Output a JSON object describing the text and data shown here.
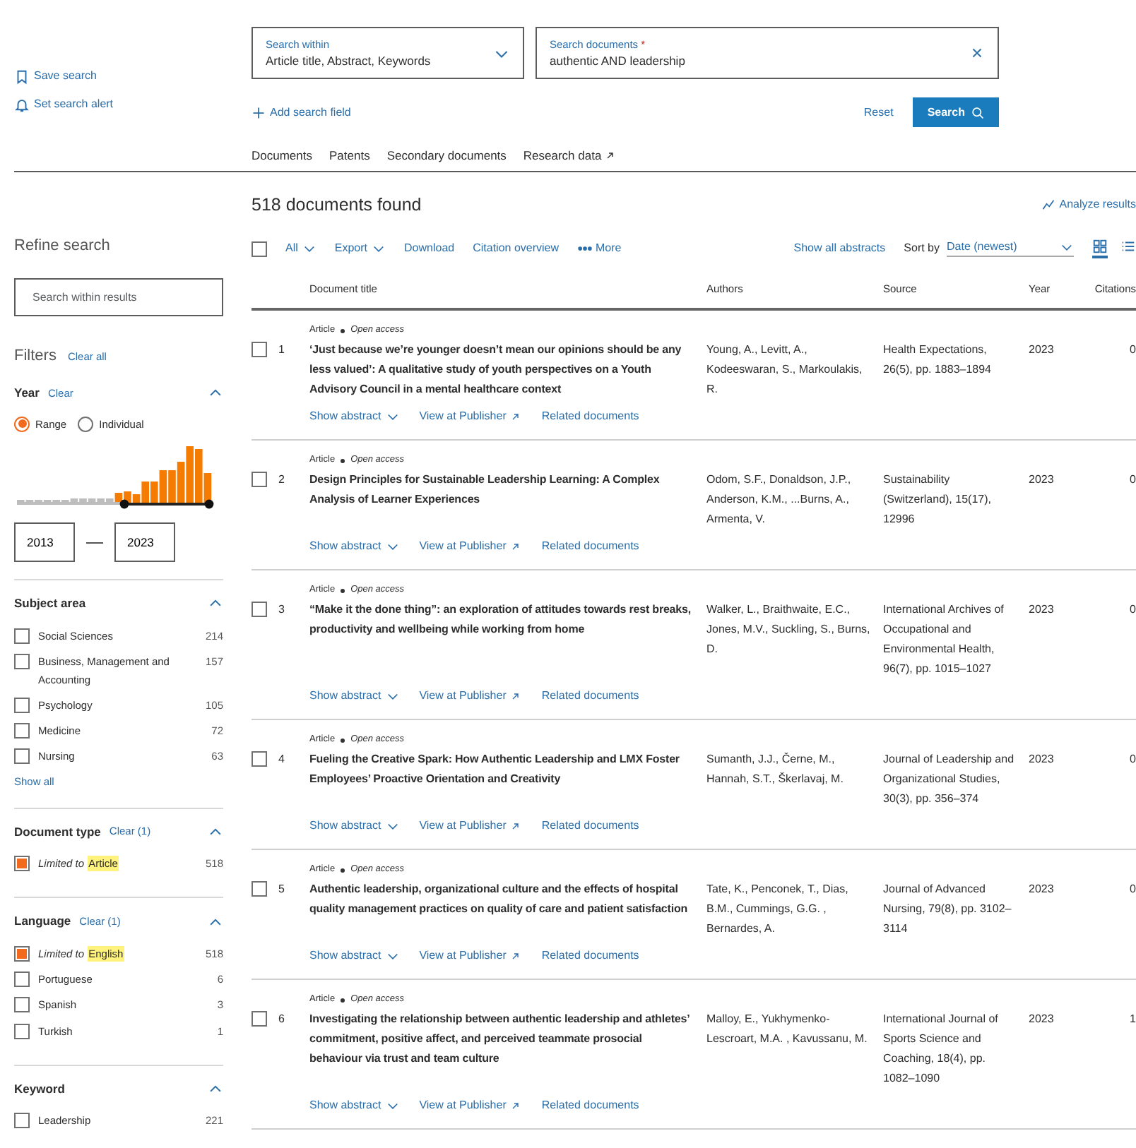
{
  "sidebar_actions": [
    {
      "kind": "bookmark",
      "label": "Save search"
    },
    {
      "kind": "bell",
      "label": "Set search alert"
    }
  ],
  "search": {
    "within": {
      "label": "Search within",
      "value": "Article title, Abstract, Keywords"
    },
    "query": {
      "label": "Search documents",
      "required_mark": "*",
      "value": "authentic AND leadership"
    },
    "add_field": "Add search field",
    "reset": "Reset",
    "submit": "Search"
  },
  "tabs": [
    {
      "label": "Documents",
      "external": false
    },
    {
      "label": "Patents",
      "external": false
    },
    {
      "label": "Secondary documents",
      "external": false
    },
    {
      "label": "Research data",
      "external": true
    }
  ],
  "refine": {
    "title": "Refine search",
    "placeholder": "Search within results"
  },
  "filters": {
    "title": "Filters",
    "clear_all": "Clear all"
  },
  "year": {
    "title": "Year",
    "clear": "Clear",
    "expanded": true,
    "modes": [
      {
        "label": "Range",
        "selected": true
      },
      {
        "label": "Individual",
        "selected": false
      }
    ],
    "from": "2013",
    "to": "2023"
  },
  "facets": [
    {
      "title": "Subject area",
      "expanded": true,
      "show_all": "Show all",
      "items": [
        {
          "label": "Social Sciences",
          "count": "214",
          "checked": false
        },
        {
          "label": "Business, Management and Accounting",
          "count": "157",
          "checked": false
        },
        {
          "label": "Psychology",
          "count": "105",
          "checked": false
        },
        {
          "label": "Medicine",
          "count": "72",
          "checked": false
        },
        {
          "label": "Nursing",
          "count": "63",
          "checked": false
        }
      ]
    },
    {
      "title": "Document type",
      "clear": "Clear (1)",
      "expanded": true,
      "items": [
        {
          "prefix": "Limited to",
          "label": "Article",
          "count": "518",
          "checked": true
        }
      ]
    },
    {
      "title": "Language",
      "clear": "Clear (1)",
      "expanded": true,
      "items": [
        {
          "prefix": "Limited to",
          "label": "English",
          "count": "518",
          "checked": true
        },
        {
          "label": "Portuguese",
          "count": "6",
          "checked": false
        },
        {
          "label": "Spanish",
          "count": "3",
          "checked": false
        },
        {
          "label": "Turkish",
          "count": "1",
          "checked": false
        }
      ]
    },
    {
      "title": "Keyword",
      "expanded": true,
      "items": [
        {
          "label": "Leadership",
          "count": "221",
          "checked": false
        }
      ]
    }
  ],
  "results": {
    "count_text": "518 documents found",
    "analyze": "Analyze results",
    "toolbar": {
      "all_checked": false,
      "all": "All",
      "export": "Export",
      "download": "Download",
      "citation_overview": "Citation overview",
      "more": "More",
      "show_all_abstracts": "Show all abstracts",
      "sort_label": "Sort by",
      "sort_value": "Date (newest)"
    },
    "view_modes": [
      {
        "kind": "grid",
        "selected": true
      },
      {
        "kind": "list",
        "selected": false
      }
    ],
    "columns": [
      "Document title",
      "Authors",
      "Source",
      "Year",
      "Citations"
    ],
    "rows": [
      {
        "checked": false,
        "number": "1",
        "type": "Article",
        "access": "Open access",
        "title": "‘Just because we’re younger doesn’t mean our opinions should be any less valued’: A qualitative study of youth perspectives on a Youth Advisory Council in a mental healthcare context",
        "authors": "Young, A., Levitt, A., Kodeeswaran, S., Markoulakis, R.",
        "source": "Health Expectations, 26(5), pp. 1883–1894",
        "year": "2023",
        "citations": "0",
        "links": [
          "Show abstract",
          "View at Publisher",
          "Related documents"
        ]
      },
      {
        "checked": false,
        "number": "2",
        "type": "Article",
        "access": "Open access",
        "title": "Design Principles for Sustainable Leadership Learning: A Complex Analysis of Learner Experiences",
        "authors": "Odom, S.F., Donaldson, J.P., Anderson, K.M., ...Burns, A., Armenta, V.",
        "source": "Sustainability (Switzerland), 15(17), 12996",
        "year": "2023",
        "citations": "0",
        "links": [
          "Show abstract",
          "View at Publisher",
          "Related documents"
        ]
      },
      {
        "checked": false,
        "number": "3",
        "type": "Article",
        "access": "Open access",
        "title": "“Make it the done thing”: an exploration of attitudes towards rest breaks, productivity and wellbeing while working from home",
        "authors": "Walker, L., Braithwaite, E.C., Jones, M.V., Suckling, S., Burns, D.",
        "source": "International Archives of Occupational and Environmental Health, 96(7), pp. 1015–1027",
        "year": "2023",
        "citations": "0",
        "links": [
          "Show abstract",
          "View at Publisher",
          "Related documents"
        ]
      },
      {
        "checked": false,
        "number": "4",
        "type": "Article",
        "access": "Open access",
        "title": "Fueling the Creative Spark: How Authentic Leadership and LMX Foster Employees’ Proactive Orientation and Creativity",
        "authors": "Sumanth, J.J., Černe, M., Hannah, S.T., Škerlavaj, M.",
        "source": "Journal of Leadership and Organizational Studies, 30(3), pp. 356–374",
        "year": "2023",
        "citations": "0",
        "links": [
          "Show abstract",
          "View at Publisher",
          "Related documents"
        ]
      },
      {
        "checked": false,
        "number": "5",
        "type": "Article",
        "access": "Open access",
        "title": "Authentic leadership, organizational culture and the effects of hospital quality management practices on quality of care and patient satisfaction",
        "authors": "Tate, K., Penconek, T., Dias, B.M., Cummings, G.G. , Bernardes, A.",
        "source": "Journal of Advanced Nursing, 79(8), pp. 3102–3114",
        "year": "2023",
        "citations": "0",
        "links": [
          "Show abstract",
          "View at Publisher",
          "Related documents"
        ]
      },
      {
        "checked": false,
        "number": "6",
        "type": "Article",
        "access": "Open access",
        "title": "Investigating the relationship between authentic leadership and athletes’ commitment, positive affect, and perceived teammate prosocial behaviour via trust and team culture",
        "authors": "Malloy, E., Yukhymenko-Lescroart, M.A. , Kavussanu, M.",
        "source": "International Journal of Sports Science and Coaching, 18(4), pp. 1082–1090",
        "year": "2023",
        "citations": "1",
        "links": [
          "Show abstract",
          "View at Publisher",
          "Related documents"
        ]
      }
    ]
  }
}
